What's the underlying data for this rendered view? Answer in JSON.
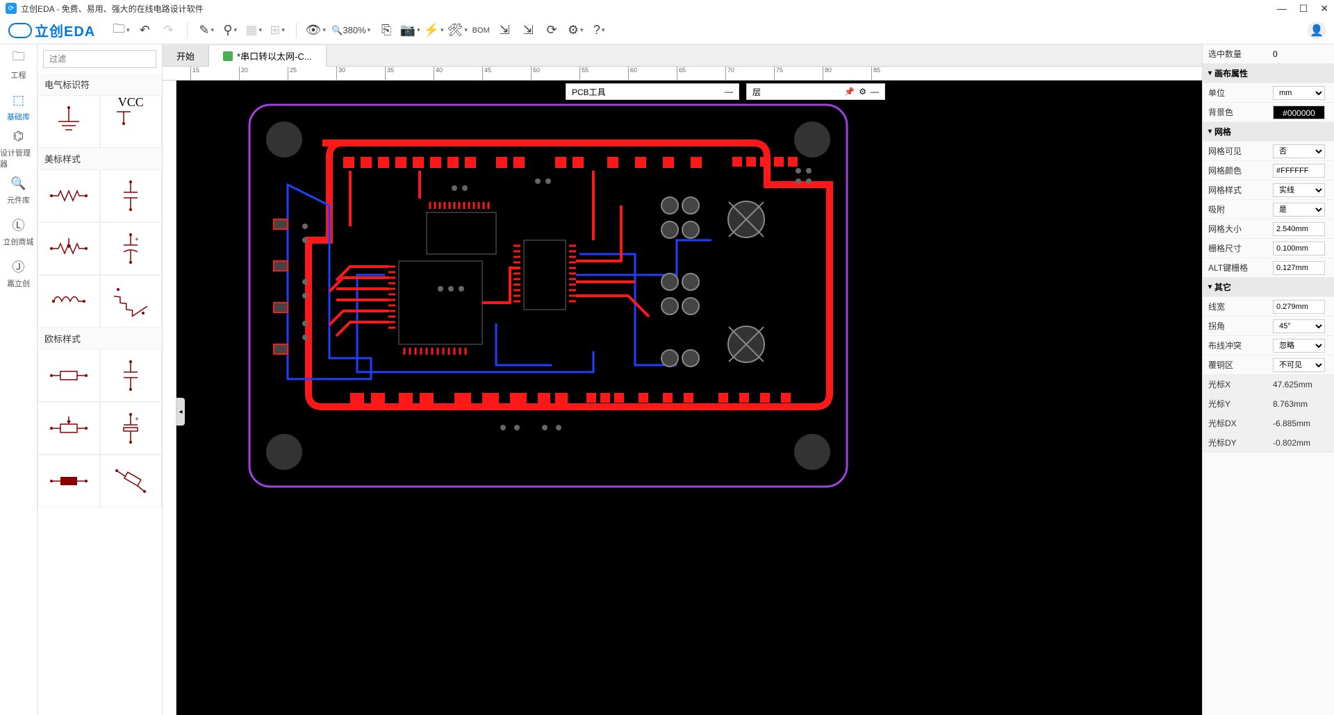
{
  "titlebar": {
    "title": "立创EDA - 免费、易用、强大的在线电路设计软件"
  },
  "logo": {
    "text": "立创EDA"
  },
  "toolbar": {
    "zoom": "380%",
    "bom": "BOM"
  },
  "leftRail": {
    "items": [
      {
        "label": "工程",
        "icon": "folder"
      },
      {
        "label": "基础库",
        "icon": "chip",
        "active": true
      },
      {
        "label": "设计管理器",
        "icon": "tree"
      },
      {
        "label": "元件库",
        "icon": "search"
      },
      {
        "label": "立创商城",
        "icon": "lcsc"
      },
      {
        "label": "嘉立创",
        "icon": "jlc"
      }
    ]
  },
  "libPanel": {
    "filterPlaceholder": "过滤",
    "sections": {
      "electrical": "电气标识符",
      "us": "美标样式",
      "eu": "欧标样式"
    },
    "vcc": "VCC"
  },
  "tabs": {
    "start": "开始",
    "file": "*串口转以太网-C..."
  },
  "ruler": {
    "ticks": [
      "15",
      "20",
      "25",
      "30",
      "35",
      "40",
      "45",
      "50",
      "55",
      "60",
      "65",
      "70",
      "75",
      "80",
      "85"
    ]
  },
  "floating": {
    "pcbTools": "PCB工具",
    "layer": "层"
  },
  "rightPanel": {
    "selectedCount": {
      "label": "选中数量",
      "value": "0"
    },
    "sections": {
      "canvas": "画布属性",
      "grid": "网格",
      "other": "其它"
    },
    "props": {
      "unit": {
        "label": "单位",
        "value": "mm"
      },
      "bgcolor": {
        "label": "背景色",
        "value": "#000000"
      },
      "gridVisible": {
        "label": "网格可见",
        "value": "否"
      },
      "gridColor": {
        "label": "网格颜色",
        "value": "#FFFFFF"
      },
      "gridStyle": {
        "label": "网格样式",
        "value": "实线"
      },
      "snap": {
        "label": "吸附",
        "value": "是"
      },
      "gridSize": {
        "label": "网格大小",
        "value": "2.540mm"
      },
      "gridRuler": {
        "label": "栅格尺寸",
        "value": "0.100mm"
      },
      "altGrid": {
        "label": "ALT键栅格",
        "value": "0.127mm"
      },
      "lineWidth": {
        "label": "线宽",
        "value": "0.279mm"
      },
      "corner": {
        "label": "拐角",
        "value": "45°"
      },
      "routeConflict": {
        "label": "布线冲突",
        "value": "忽略"
      },
      "copperZone": {
        "label": "覆铜区",
        "value": "不可见"
      },
      "cursorX": {
        "label": "光标X",
        "value": "47.625mm"
      },
      "cursorY": {
        "label": "光标Y",
        "value": "8.763mm"
      },
      "cursorDX": {
        "label": "光标DX",
        "value": "-6.885mm"
      },
      "cursorDY": {
        "label": "光标DY",
        "value": "-0.802mm"
      }
    }
  }
}
